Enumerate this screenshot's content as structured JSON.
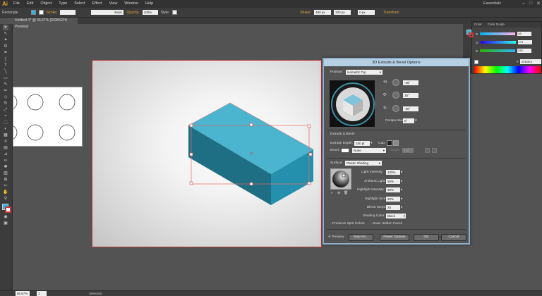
{
  "app": {
    "logo": "Ai",
    "workspace": "Essentials",
    "window_buttons": [
      "–",
      "□",
      "✕"
    ]
  },
  "menu": [
    "File",
    "Edit",
    "Object",
    "Type",
    "Select",
    "Effect",
    "View",
    "Window",
    "Help"
  ],
  "control_bar": {
    "selection": "Rectangle",
    "stroke_label": "Stroke:",
    "brush": "Basic",
    "opacity_label": "Opacity:",
    "opacity_value": "100%",
    "style_label": "Style:",
    "shape_label": "Shape:",
    "shape_w": "480 px",
    "shape_h": "320 px",
    "corner": "0 px",
    "transform_label": "Transform"
  },
  "document_tab": "Untitled-1* @ 66.67% (RGB/GPU Preview)",
  "color_panel": {
    "tabs": [
      "Color",
      "Color Guide"
    ],
    "r_label": "R",
    "r_value": "46",
    "g_label": "G",
    "g_value": "179",
    "b_label": "B",
    "b_value": "234",
    "hex": "2EB3EA",
    "hex_prefix": "#"
  },
  "dialog": {
    "title": "3D Extrude & Bevel Options",
    "position_label": "Position:",
    "position_value": "Isometric Top",
    "rot_x": "-45°",
    "rot_y": "35°",
    "rot_z": "-30°",
    "perspective_label": "Perspective:",
    "perspective_value": "0°",
    "extrude_section": "Extrude & Bevel",
    "extrude_depth_label": "Extrude Depth:",
    "extrude_depth_value": "180 pt",
    "cap_label": "Cap:",
    "bevel_label": "Bevel:",
    "bevel_value": "None",
    "height_label": "Height:",
    "height_value": "4 pt",
    "surface_label": "Surface:",
    "surface_value": "Plastic Shading",
    "light_intensity_label": "Light Intensity:",
    "light_intensity_value": "100%",
    "ambient_light_label": "Ambient Light:",
    "ambient_light_value": "50%",
    "highlight_intensity_label": "Highlight Intensity:",
    "highlight_intensity_value": "60%",
    "highlight_size_label": "Highlight Size:",
    "highlight_size_value": "90%",
    "blend_steps_label": "Blend Steps:",
    "blend_steps_value": "25",
    "shading_color_label": "Shading Color:",
    "shading_color_value": "Black",
    "preserve_spot": "Preserve Spot Colors",
    "draw_hidden": "Draw Hidden Faces",
    "preview_label": "Preview",
    "map_art": "Map Art...",
    "fewer_options": "Fewer Options",
    "ok": "OK",
    "cancel": "Cancel"
  },
  "status": {
    "zoom": "66.67%",
    "page": "1",
    "tool": "Selection"
  },
  "colors": {
    "box_top": "#4bb5cf",
    "box_front": "#1f6f84",
    "box_side": "#2590ad",
    "accent": "#2eb3ea"
  }
}
